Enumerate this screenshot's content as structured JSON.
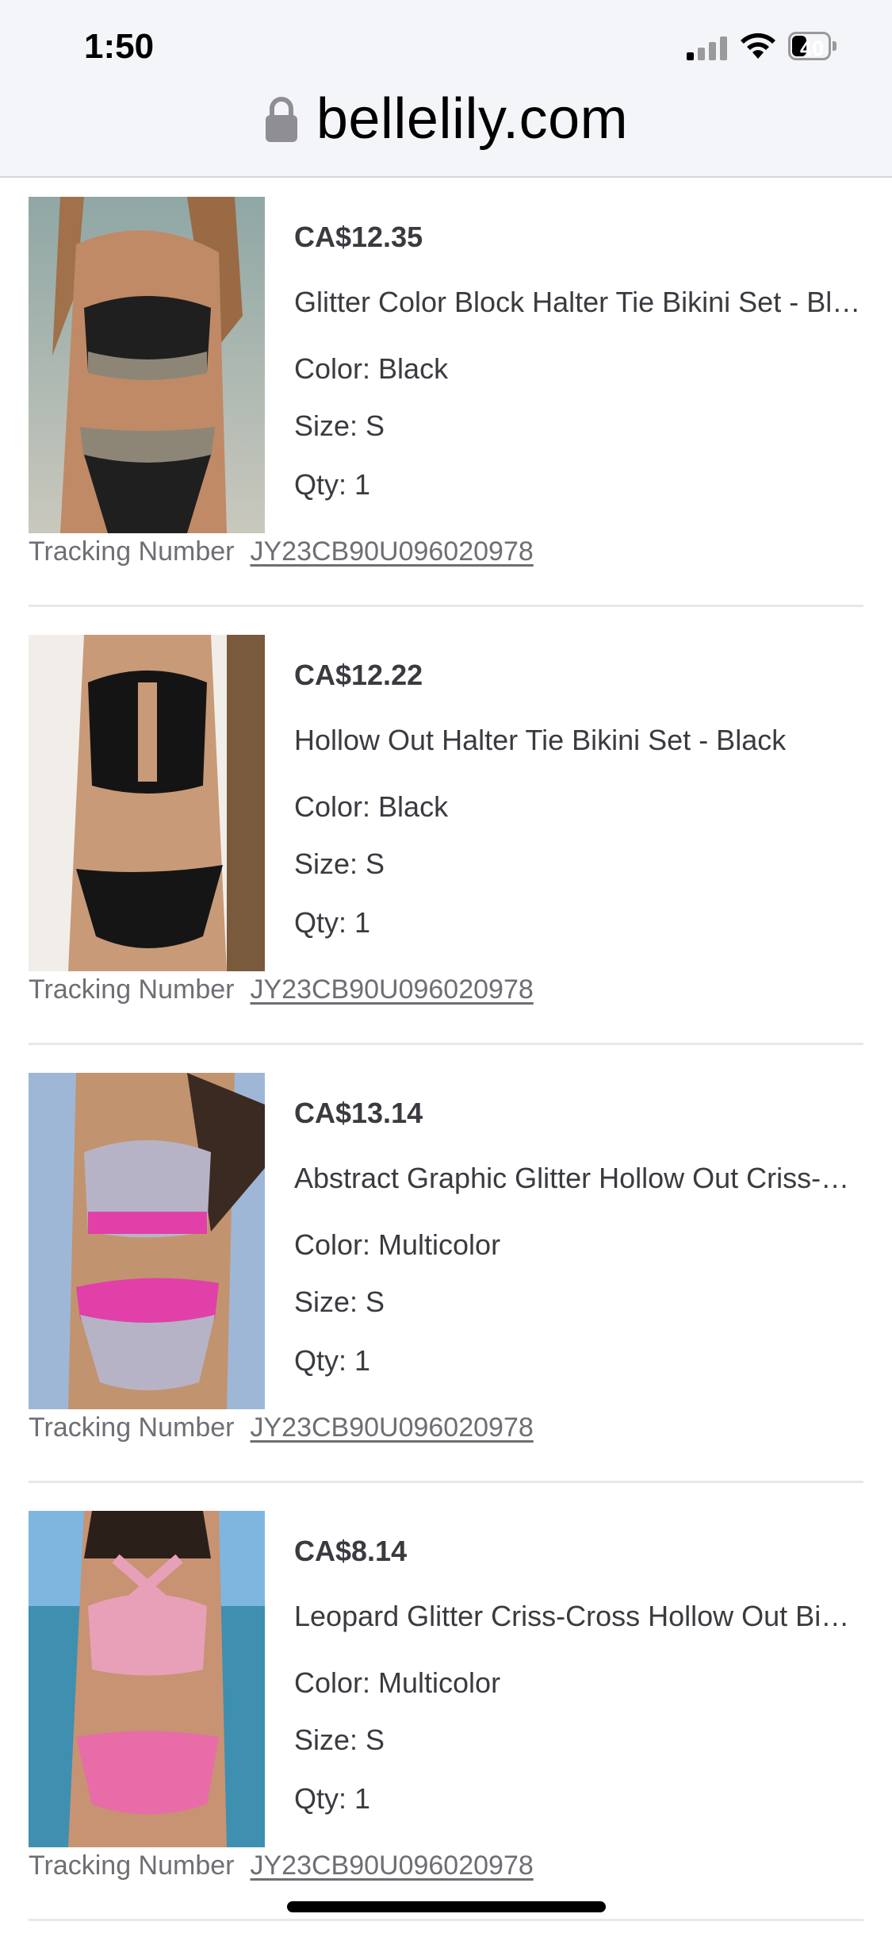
{
  "status_bar": {
    "time": "1:50",
    "battery_level": "40"
  },
  "url_bar": {
    "domain": "bellelily.com"
  },
  "tracking_label": "Tracking Number",
  "items": [
    {
      "price": "CA$12.35",
      "title": "Glitter Color Block Halter Tie Bikini Set - Black",
      "color": "Color: Black",
      "size": "Size: S",
      "qty": "Qty: 1",
      "tracking_number": "JY23CB90U096020978"
    },
    {
      "price": "CA$12.22",
      "title": "Hollow Out Halter Tie Bikini Set - Black",
      "color": "Color: Black",
      "size": "Size: S",
      "qty": "Qty: 1",
      "tracking_number": "JY23CB90U096020978"
    },
    {
      "price": "CA$13.14",
      "title": "Abstract Graphic Glitter Hollow Out Criss-Cross Bikini Set",
      "color": "Color: Multicolor",
      "size": "Size: S",
      "qty": "Qty: 1",
      "tracking_number": "JY23CB90U096020978"
    },
    {
      "price": "CA$8.14",
      "title": "Leopard Glitter Criss-Cross Hollow Out Bikini Set",
      "color": "Color: Multicolor",
      "size": "Size: S",
      "qty": "Qty: 1",
      "tracking_number": "JY23CB90U096020978"
    }
  ]
}
